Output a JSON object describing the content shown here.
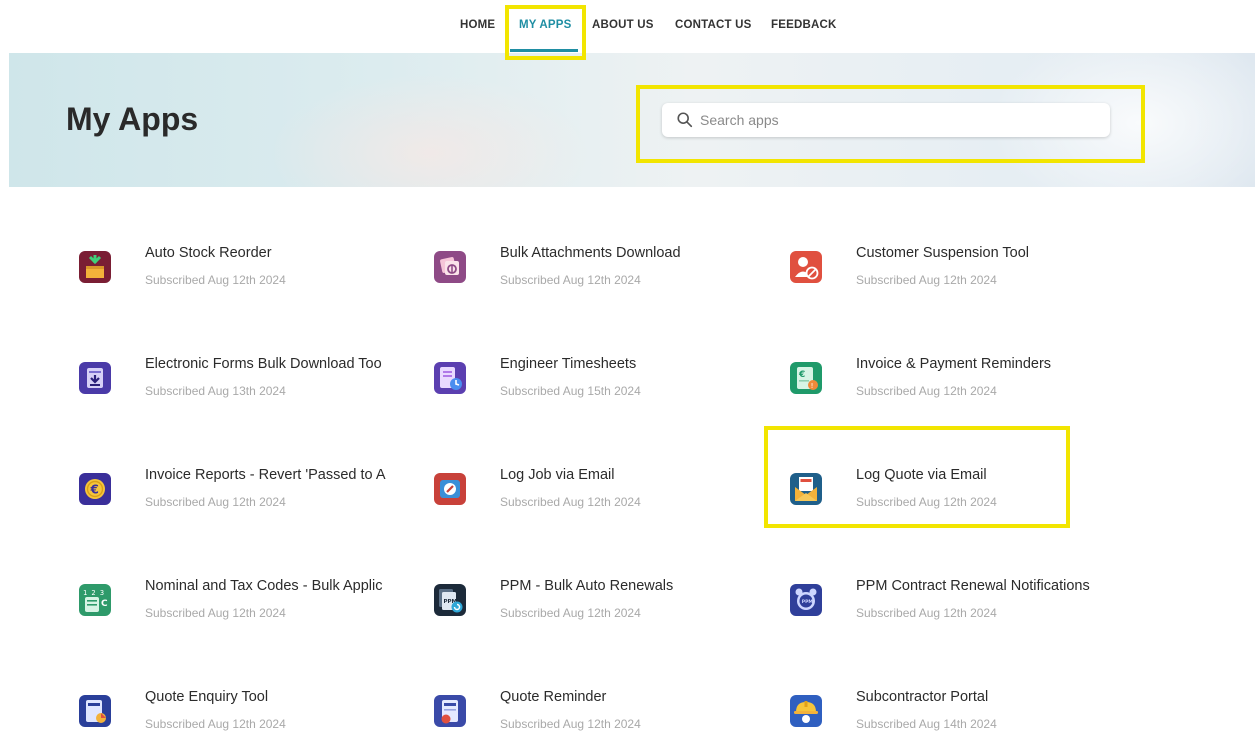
{
  "nav": {
    "items": [
      "HOME",
      "MY APPS",
      "ABOUT US",
      "CONTACT US",
      "FEEDBACK"
    ],
    "active": "MY APPS",
    "accent_color": "#1f8ea3"
  },
  "page": {
    "title": "My Apps"
  },
  "search": {
    "placeholder": "Search apps",
    "value": ""
  },
  "apps": [
    {
      "name": "Auto Stock Reorder",
      "subscribed": "Subscribed Aug 12th 2024",
      "icon": "box-download-icon",
      "color": "#7a1e34"
    },
    {
      "name": "Bulk Attachments Download",
      "subscribed": "Subscribed Aug 12th 2024",
      "icon": "attachments-icon",
      "color": "#8e4a86"
    },
    {
      "name": "Customer Suspension Tool",
      "subscribed": "Subscribed Aug 12th 2024",
      "icon": "user-block-icon",
      "color": "#e0503f"
    },
    {
      "name": "Electronic Forms Bulk Download Too",
      "subscribed": "Subscribed Aug 13th 2024",
      "icon": "forms-download-icon",
      "color": "#4a3aa8"
    },
    {
      "name": "Engineer Timesheets",
      "subscribed": "Subscribed Aug 15th 2024",
      "icon": "timesheet-icon",
      "color": "#5b3fb0"
    },
    {
      "name": "Invoice & Payment Reminders",
      "subscribed": "Subscribed Aug 12th 2024",
      "icon": "invoice-reminder-icon",
      "color": "#1f9a6a"
    },
    {
      "name": "Invoice Reports - Revert 'Passed to A",
      "subscribed": "Subscribed Aug 12th 2024",
      "icon": "euro-coin-icon",
      "color": "#3a2f9a"
    },
    {
      "name": "Log Job via Email",
      "subscribed": "Subscribed Aug 12th 2024",
      "icon": "job-email-icon",
      "color": "#c8413a"
    },
    {
      "name": "Log Quote via Email",
      "subscribed": "Subscribed Aug 12th 2024",
      "icon": "quote-email-icon",
      "color": "#1f5f8a"
    },
    {
      "name": "Nominal and Tax Codes - Bulk Applic",
      "subscribed": "Subscribed Aug 12th 2024",
      "icon": "tax-codes-icon",
      "color": "#2e9a6a"
    },
    {
      "name": "PPM - Bulk Auto Renewals",
      "subscribed": "Subscribed Aug 12th 2024",
      "icon": "ppm-renewal-icon",
      "color": "#1c2a3a"
    },
    {
      "name": "PPM Contract Renewal Notifications",
      "subscribed": "Subscribed Aug 12th 2024",
      "icon": "alarm-clock-icon",
      "color": "#2f3f9a"
    },
    {
      "name": "Quote Enquiry Tool",
      "subscribed": "Subscribed Aug 12th 2024",
      "icon": "quote-enquiry-icon",
      "color": "#2a3f9a"
    },
    {
      "name": "Quote Reminder",
      "subscribed": "Subscribed Aug 12th 2024",
      "icon": "quote-reminder-icon",
      "color": "#3a4aa8"
    },
    {
      "name": "Subcontractor Portal",
      "subscribed": "Subscribed Aug 14th 2024",
      "icon": "hardhat-icon",
      "color": "#2f5fc0"
    }
  ]
}
